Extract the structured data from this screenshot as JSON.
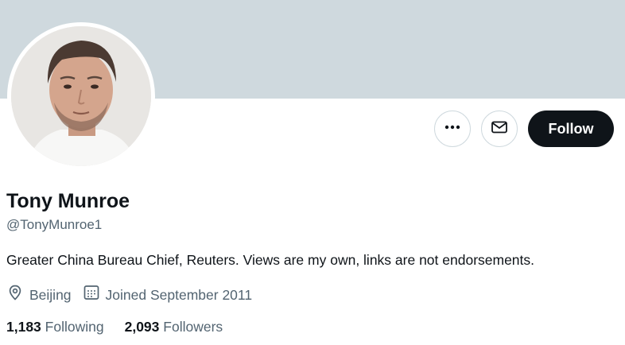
{
  "profile": {
    "name": "Tony Munroe",
    "handle": "@TonyMunroe1",
    "bio": "Greater China Bureau Chief, Reuters. Views are my own, links are not endorsements.",
    "location": "Beijing",
    "joined": "Joined September 2011"
  },
  "actions": {
    "more_icon": "more-horizontal-icon",
    "message_icon": "mail-icon",
    "follow_label": "Follow"
  },
  "stats": {
    "following_count": "1,183",
    "following_label": "Following",
    "followers_count": "2,093",
    "followers_label": "Followers"
  },
  "colors": {
    "banner": "#cfd9de",
    "follow_button": "#0f1419",
    "secondary_text": "#536471"
  }
}
